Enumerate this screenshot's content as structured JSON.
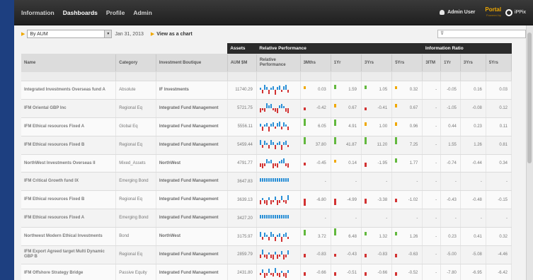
{
  "nav": {
    "items": [
      "Information",
      "Dashboards",
      "Profile",
      "Admin"
    ],
    "active": "Dashboards"
  },
  "user": {
    "name": "Admin User"
  },
  "portal": {
    "label": "Portal",
    "sublabel": "Powered by",
    "brand": "iPPix"
  },
  "toolbar": {
    "view_select": "By AUM",
    "date": "Jan 31, 2013",
    "chart_link": "View as a chart",
    "filter_placeholder": ""
  },
  "groups": {
    "assets": "Assets",
    "relative": "Relative Performance",
    "info": "Information Ratio"
  },
  "columns": [
    "Name",
    "Category",
    "Investment Boutique",
    "AUM $M",
    "Relative Performance",
    "3Mths",
    "1Yr",
    "3Yrs",
    "5Yrs",
    "3ITM",
    "1Yr",
    "3Yrs",
    "5Yrs"
  ],
  "rows": [
    {
      "name": "Integrated Investments Overseas fund A",
      "cat": "Absolute",
      "bout": "IF Investments",
      "aum": "11740.29",
      "perf": [
        "0.03",
        "1.59",
        "1.05",
        "0.32"
      ],
      "ir": [
        "-",
        "-0.05",
        "0.16",
        "0.03"
      ]
    },
    {
      "name": "IFM Oriental GBP Inc",
      "cat": "Regional Eq",
      "bout": "Integrated Fund Management",
      "aum": "5721.75",
      "perf": [
        "-0.42",
        "0.67",
        "-0.41",
        "0.67"
      ],
      "ir": [
        "-",
        "-1.05",
        "-0.08",
        "0.12"
      ]
    },
    {
      "name": "IFM Ethical resources Fixed A",
      "cat": "Global Eq",
      "bout": "Integrated Fund Management",
      "aum": "5556.11",
      "perf": [
        "6.05",
        "4.91",
        "1.00",
        "0.96"
      ],
      "ir": [
        "-",
        "0.44",
        "0.23",
        "0.11"
      ]
    },
    {
      "name": "IFM Ethical resources Fixed B",
      "cat": "Regional Eq",
      "bout": "Integrated Fund Management",
      "aum": "5459.44",
      "perf": [
        "37.80",
        "41.87",
        "11.20",
        "7.25"
      ],
      "ir": [
        "-",
        "1.55",
        "1.26",
        "0.81"
      ]
    },
    {
      "name": "NorthWest Investments Overseas II",
      "cat": "Mixed_Assets",
      "bout": "NorthWest",
      "aum": "4791.77",
      "perf": [
        "-0.45",
        "0.14",
        "-1.95",
        "1.77"
      ],
      "ir": [
        "-",
        "-0.74",
        "-0.44",
        "0.34"
      ]
    },
    {
      "name": "IFM Critical Growth fund IX",
      "cat": "Emerging Bond",
      "bout": "Integrated Fund Management",
      "aum": "3647.83",
      "perf": [
        "-",
        "-",
        "-",
        "-"
      ],
      "ir": [
        "-",
        "-",
        "-",
        "-"
      ]
    },
    {
      "name": "IFM Ethical resources Fixed B",
      "cat": "Regional Eq",
      "bout": "Integrated Fund Management",
      "aum": "3639.13",
      "perf": [
        "-6.80",
        "-4.99",
        "-3.38",
        "-1.02"
      ],
      "ir": [
        "-",
        "-0.43",
        "-0.48",
        "-0.15"
      ]
    },
    {
      "name": "IFM Ethical resources Fixed A",
      "cat": "Emerging Bond",
      "bout": "Integrated Fund Management",
      "aum": "3427.20",
      "perf": [
        "-",
        "-",
        "-",
        "-"
      ],
      "ir": [
        "-",
        "-",
        "-",
        "-"
      ]
    },
    {
      "name": "Northwest Modern Ethical Investments",
      "cat": "Bond",
      "bout": "NorthWest",
      "aum": "3175.97",
      "perf": [
        "3.72",
        "6.48",
        "1.32",
        "1.26"
      ],
      "ir": [
        "-",
        "0.23",
        "0.41",
        "0.32"
      ]
    },
    {
      "name": "IFM Export Agreed target Multi Dynamic GBP B",
      "cat": "Regional Eq",
      "bout": "Integrated Fund Management",
      "aum": "2859.79",
      "perf": [
        "-0.83",
        "-0.43",
        "-0.83",
        "-0.63"
      ],
      "ir": [
        "-",
        "-5.00",
        "-5.08",
        "-4.46"
      ]
    },
    {
      "name": "IFM Offshore Strategy Bridge",
      "cat": "Passive Equity",
      "bout": "Integrated Fund Management",
      "aum": "2431.80",
      "perf": [
        "-0.66",
        "-0.51",
        "-0.66",
        "-0.52"
      ],
      "ir": [
        "-",
        "-7.80",
        "-6.95",
        "-6.42"
      ]
    }
  ]
}
